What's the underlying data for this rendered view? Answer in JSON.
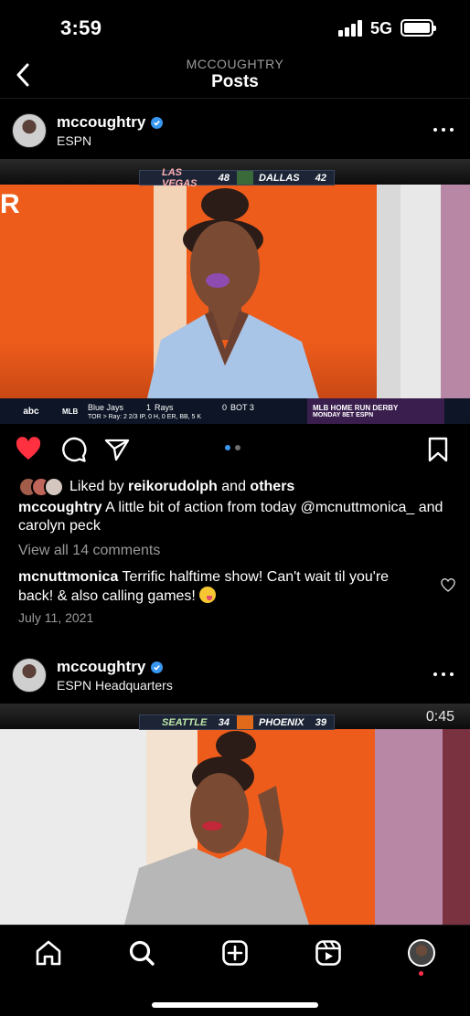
{
  "status_bar": {
    "time": "3:59",
    "network": "5G"
  },
  "header": {
    "subtitle": "MCCOUGHTRY",
    "title": "Posts"
  },
  "post1": {
    "username": "mccoughtry",
    "location": "ESPN",
    "scorebug": {
      "team1": "LAS VEGAS",
      "score1": "48",
      "team2": "DALLAS",
      "score2": "42"
    },
    "ticker": {
      "network": "abc",
      "league": "MLB",
      "team1": "Blue Jays",
      "score1": "1",
      "team2": "Rays",
      "score2": "0",
      "inning": "BOT 3",
      "pitcher_line": "TOR  >  Ray: 2 2/3 IP, 0 H, 0 ER, BB, 5 K",
      "promo_line1": "MLB HOME RUN DERBY",
      "promo_line2": "MONDAY 8ET ESPN"
    },
    "liked_by_prefix": "Liked by ",
    "liked_by_user": "reikorudolph",
    "liked_by_suffix": " and ",
    "liked_by_others": "others",
    "caption_user": "mccoughtry",
    "caption_text": " A little bit of action from today @mcnuttmonica_  and carolyn peck",
    "view_comments": "View all 14 comments",
    "comment_user": "mcnuttmonica",
    "comment_text": " Terrific halftime show! Can't wait til you're back! & also calling games! ",
    "date": "July 11, 2021"
  },
  "post2": {
    "username": "mccoughtry",
    "location": "ESPN Headquarters",
    "scorebug": {
      "team1": "SEATTLE",
      "score1": "34",
      "team2": "PHOENIX",
      "score2": "39"
    },
    "video_time": "0:45"
  },
  "colors": {
    "accent": "#3897f0",
    "like_red": "#ff3040",
    "orange_set": "#f0601e"
  },
  "icons": [
    "back-chevron",
    "verified-badge",
    "more-dots",
    "heart-filled",
    "comment-bubble",
    "share-plane",
    "bookmark",
    "home",
    "search",
    "create-plus",
    "reels",
    "profile"
  ]
}
